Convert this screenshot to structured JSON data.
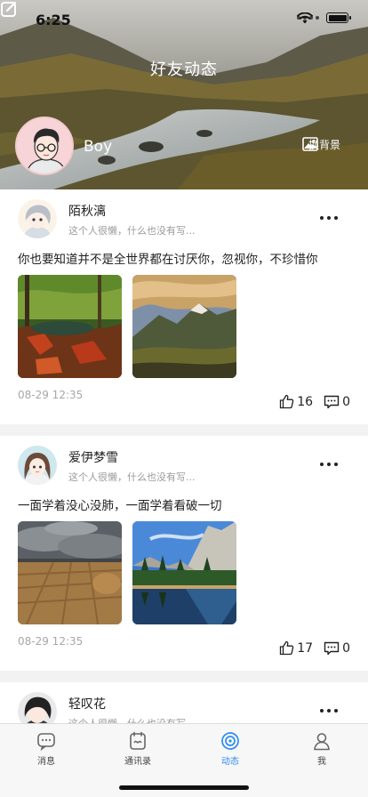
{
  "status_bar": {
    "time": "6:25"
  },
  "header": {
    "title": "好友动态",
    "profile_name": "Boy",
    "change_background_label": "换背景"
  },
  "posts": [
    {
      "author": "陌秋漓",
      "bio": "这个人很懒，什么也没有写...",
      "text": "你也要知道并不是全世界都在讨厌你，忽视你，不珍惜你",
      "time": "08-29 12:35",
      "likes": "16",
      "comments": "0"
    },
    {
      "author": "爱伊梦雪",
      "bio": "这个人很懒，什么也没有写...",
      "text": "一面学着没心没肺，一面学着看破一切",
      "time": "08-29 12:35",
      "likes": "17",
      "comments": "0"
    },
    {
      "author": "轻叹花",
      "bio": "这个人很懒，什么也没有写..."
    }
  ],
  "tabbar": {
    "items": [
      {
        "label": "消息",
        "icon": "message-icon"
      },
      {
        "label": "通讯录",
        "icon": "contacts-icon"
      },
      {
        "label": "动态",
        "icon": "moments-icon",
        "active": true
      },
      {
        "label": "我",
        "icon": "profile-icon"
      }
    ]
  },
  "colors": {
    "accent": "#2d8cf0",
    "bio_text": "#9a9a9a",
    "time_text": "#a7a7a7"
  }
}
